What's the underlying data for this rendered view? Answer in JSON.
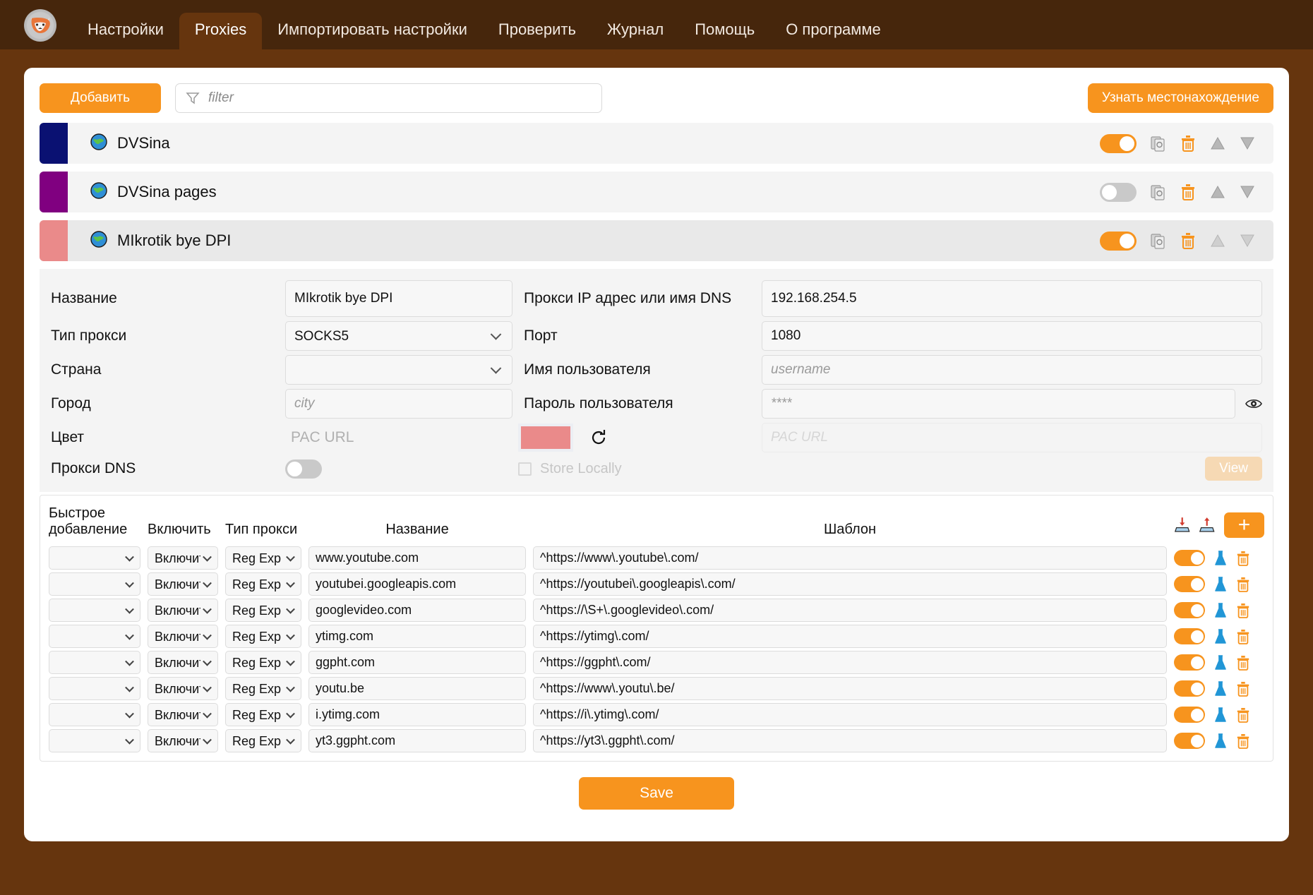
{
  "app": {
    "logo_icon": "fox-logo-icon",
    "nav": [
      {
        "label": "Настройки",
        "active": false
      },
      {
        "label": "Proxies",
        "active": true
      },
      {
        "label": "Импортировать настройки",
        "active": false
      },
      {
        "label": "Проверить",
        "active": false
      },
      {
        "label": "Журнал",
        "active": false
      },
      {
        "label": "Помощь",
        "active": false
      },
      {
        "label": "О программе",
        "active": false
      }
    ]
  },
  "toolbar": {
    "add_label": "Добавить",
    "filter_placeholder": "filter",
    "filter_value": "",
    "filter_icon": "funnel-icon",
    "locate_label": "Узнать местонахождение"
  },
  "proxies": [
    {
      "name": "DVSina",
      "color": "#0a1172",
      "enabled": true,
      "selected": false,
      "icon": "globe-icon"
    },
    {
      "name": "DVSina pages",
      "color": "#800080",
      "enabled": false,
      "selected": false,
      "icon": "globe-icon"
    },
    {
      "name": "MIkrotik bye DPI",
      "color": "#ea8a8a",
      "enabled": true,
      "selected": true,
      "icon": "globe-icon"
    }
  ],
  "row_icons": {
    "copy": "copy-icon",
    "delete": "trash-icon",
    "move_up": "triangle-up-icon",
    "move_down": "triangle-down-icon"
  },
  "detail": {
    "name_label": "Название",
    "name_value": "MIkrotik bye DPI",
    "proxy_type_label": "Тип прокси",
    "proxy_type_value": "SOCKS5",
    "country_label": "Страна",
    "country_value": "",
    "city_label": "Город",
    "city_placeholder": "city",
    "city_value": "",
    "color_label": "Цвет",
    "color_value": "#ea8a8a",
    "color_reset_icon": "refresh-icon",
    "proxy_dns_label": "Прокси DNS",
    "proxy_dns_enabled": false,
    "ip_label": "Прокси IP адрес или имя DNS",
    "ip_value": "192.168.254.5",
    "port_label": "Порт",
    "port_value": "1080",
    "username_label": "Имя пользователя",
    "username_placeholder": "username",
    "username_value": "",
    "password_label": "Пароль пользователя",
    "password_placeholder": "****",
    "password_value": "",
    "password_eye_icon": "eye-icon",
    "pac_url_label": "PAC URL",
    "pac_url_placeholder": "PAC URL",
    "pac_url_value": "",
    "store_locally_label": "Store Locally",
    "store_locally_checked": false,
    "view_label": "View"
  },
  "rules_table": {
    "headers": {
      "quick_add": "Быстрое добавление",
      "enable": "Включить",
      "proxy_type": "Тип прокси",
      "name": "Название",
      "pattern": "Шаблон"
    },
    "import_icon": "import-icon",
    "export_icon": "export-icon",
    "add_label": "+",
    "row_icons": {
      "test": "flask-icon",
      "delete": "trash-icon"
    },
    "rows": [
      {
        "quick_add": "",
        "enable": "Включить",
        "type": "Reg Exp",
        "name": "www.youtube.com",
        "pattern": "^https://www\\.youtube\\.com/",
        "enabled": true
      },
      {
        "quick_add": "",
        "enable": "Включить",
        "type": "Reg Exp",
        "name": "youtubei.googleapis.com",
        "pattern": "^https://youtubei\\.googleapis\\.com/",
        "enabled": true
      },
      {
        "quick_add": "",
        "enable": "Включить",
        "type": "Reg Exp",
        "name": "googlevideo.com",
        "pattern": "^https://\\S+\\.googlevideo\\.com/",
        "enabled": true
      },
      {
        "quick_add": "",
        "enable": "Включить",
        "type": "Reg Exp",
        "name": "ytimg.com",
        "pattern": "^https://ytimg\\.com/",
        "enabled": true
      },
      {
        "quick_add": "",
        "enable": "Включить",
        "type": "Reg Exp",
        "name": "ggpht.com",
        "pattern": "^https://ggpht\\.com/",
        "enabled": true
      },
      {
        "quick_add": "",
        "enable": "Включить",
        "type": "Reg Exp",
        "name": "youtu.be",
        "pattern": "^https://www\\.youtu\\.be/",
        "enabled": true
      },
      {
        "quick_add": "",
        "enable": "Включить",
        "type": "Reg Exp",
        "name": "i.ytimg.com",
        "pattern": "^https://i\\.ytimg\\.com/",
        "enabled": true
      },
      {
        "quick_add": "",
        "enable": "Включить",
        "type": "Reg Exp",
        "name": "yt3.ggpht.com",
        "pattern": "^https://yt3\\.ggpht\\.com/",
        "enabled": true
      }
    ]
  },
  "footer": {
    "save_label": "Save"
  },
  "colors": {
    "accent": "#f7941e",
    "topbar": "#46260c",
    "page_bg": "#66350e",
    "flask": "#2196d6",
    "toggle_off": "#c9c9c9"
  }
}
